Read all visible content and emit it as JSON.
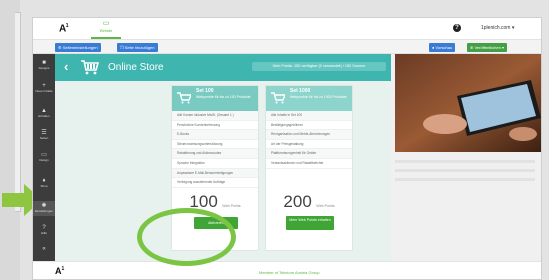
{
  "header": {
    "logo": "A",
    "logo_mark": "1",
    "nav_item": "Website",
    "help": "?",
    "site": "1plenich.com ▾"
  },
  "toolbar": {
    "settings": "⚙ Seiteneinstellungen",
    "add_page": "❐ Seite hinzufügen",
    "preview": "● Vorschau",
    "publish": "⊕ Veröffentlichen ▾"
  },
  "sidebar": [
    {
      "icon": "■",
      "label": "Designs",
      "icon_name": "design-icon"
    },
    {
      "icon": "+",
      "label": "Neue Inhalte",
      "icon_name": "plus-icon"
    },
    {
      "icon": "▲",
      "label": "Erhalten",
      "icon_name": "upload-icon"
    },
    {
      "icon": "☰",
      "label": "Seiten",
      "icon_name": "pages-icon"
    },
    {
      "icon": "▭",
      "label": "Design",
      "icon_name": "monitor-icon"
    },
    {
      "icon": "♦",
      "label": "Shop",
      "icon_name": "shop-icon"
    },
    {
      "icon": "✺",
      "label": "Einstellungen",
      "icon_name": "gear-icon"
    },
    {
      "icon": "?",
      "label": "Hilfe",
      "icon_name": "help-icon"
    },
    {
      "icon": "«",
      "label": "",
      "icon_name": "collapse-icon"
    }
  ],
  "store": {
    "back": "‹",
    "title": "Online Store",
    "points_info": "Web Points: 150 verfügbar (0 verwendet) / 150 Summe",
    "plans": [
      {
        "title": "Set 100",
        "subtitle": "Webpunkte für bis zu 100 Produkte",
        "features": [
          "Alle Kosten inklusive MwSt. (Gesamt 1 )",
          "Persönliche Kundenbetreuung",
          "E-Books",
          "Steuerzuweisungsunterstützung",
          "Rabattierung und Aktionscodes",
          "Sprache Integration",
          "Anpassbare E-Mail-Benachrichtigungen",
          "Verfolgung ausstehender Aufträge"
        ],
        "price": "100",
        "unit": "Web Points",
        "button": "Aktivieren"
      },
      {
        "title": "Set 1000",
        "subtitle": "Webpunkte für bis zu 1000 Produkte",
        "features": [
          "Alle Inhalte in Set 100",
          "Bestätigungsgebühren",
          "Reorganisation und Metrik-Abrechnungen",
          "Art der Preisgestaltung",
          "Plattformbezogenheit für Gelder",
          "Verkaufsaktionen und Rabattberichte"
        ],
        "price": "200",
        "unit": "Web Points",
        "button": "Mehr Web Points erhalten"
      }
    ]
  },
  "footer": {
    "logo": "A",
    "logo_mark": "1",
    "text": "Member of Telekom Austria Group"
  }
}
